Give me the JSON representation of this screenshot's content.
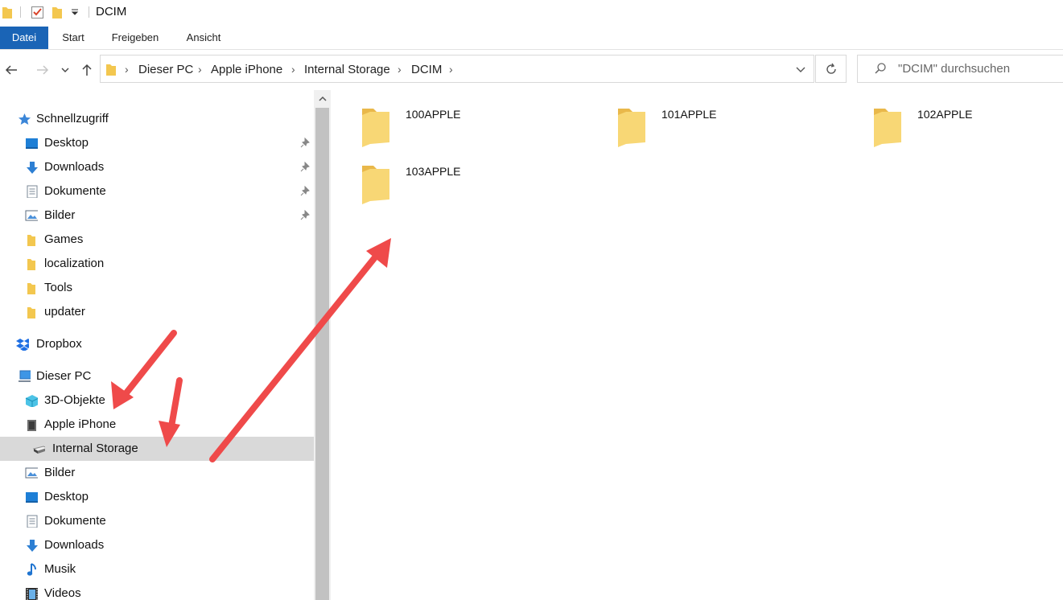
{
  "window": {
    "title": "DCIM"
  },
  "ribbon": {
    "tabs": [
      {
        "label": "Datei",
        "active": true
      },
      {
        "label": "Start"
      },
      {
        "label": "Freigeben"
      },
      {
        "label": "Ansicht"
      }
    ]
  },
  "nav_buttons": {
    "back": "←",
    "forward": "→",
    "recent": "⌄",
    "up": "↑"
  },
  "address": {
    "crumbs": [
      "Dieser PC",
      "Apple iPhone",
      "Internal Storage",
      "DCIM"
    ],
    "dropdown_icon": "chevron-down-icon",
    "refresh_icon": "refresh-icon"
  },
  "search": {
    "placeholder": "\"DCIM\" durchsuchen",
    "icon": "search-icon"
  },
  "navpane": {
    "quick_access": {
      "label": "Schnellzugriff",
      "items": [
        {
          "label": "Desktop",
          "icon": "desktop-icon",
          "pinned": true
        },
        {
          "label": "Downloads",
          "icon": "download-arrow-icon",
          "pinned": true
        },
        {
          "label": "Dokumente",
          "icon": "document-icon",
          "pinned": true
        },
        {
          "label": "Bilder",
          "icon": "pictures-icon",
          "pinned": true
        },
        {
          "label": "Games",
          "icon": "folder-icon"
        },
        {
          "label": "localization",
          "icon": "folder-icon"
        },
        {
          "label": "Tools",
          "icon": "folder-icon"
        },
        {
          "label": "updater",
          "icon": "folder-icon"
        }
      ]
    },
    "dropbox": {
      "label": "Dropbox"
    },
    "this_pc": {
      "label": "Dieser PC",
      "items": [
        {
          "label": "3D-Objekte",
          "icon": "3d-objects-icon"
        },
        {
          "label": "Apple iPhone",
          "icon": "iphone-icon"
        },
        {
          "label": "Internal Storage",
          "icon": "drive-icon",
          "selected": true,
          "indent": 2
        },
        {
          "label": "Bilder",
          "icon": "pictures-icon"
        },
        {
          "label": "Desktop",
          "icon": "desktop-icon"
        },
        {
          "label": "Dokumente",
          "icon": "document-icon"
        },
        {
          "label": "Downloads",
          "icon": "download-arrow-icon"
        },
        {
          "label": "Musik",
          "icon": "music-note-icon"
        },
        {
          "label": "Videos",
          "icon": "film-icon"
        }
      ]
    }
  },
  "content": {
    "folders": [
      {
        "name": "100APPLE"
      },
      {
        "name": "101APPLE"
      },
      {
        "name": "102APPLE"
      },
      {
        "name": "103APPLE"
      }
    ]
  },
  "colors": {
    "accent": "#1a64b6",
    "folder": "#f8d775",
    "folder_dark": "#e8b94a",
    "selection": "#d9d9d9",
    "annotation_arrow": "#ef4a4a"
  }
}
